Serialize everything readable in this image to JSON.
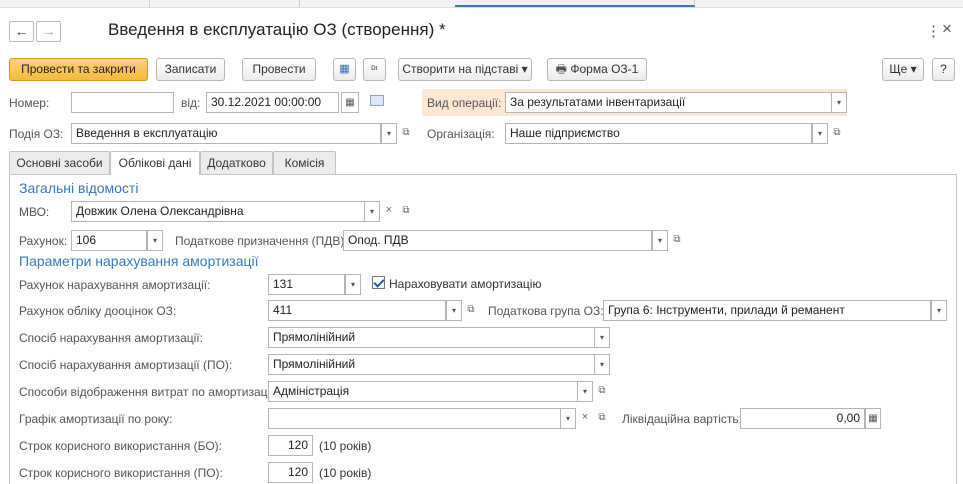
{
  "window": {
    "title": "Введення в експлуатацію ОЗ (створення) *"
  },
  "nav": {
    "back": "←",
    "forward": "→"
  },
  "window_controls": {
    "more": "⋮",
    "close": "×"
  },
  "toolbar": {
    "post_close": "Провести та закрити",
    "save": "Записати",
    "post": "Провести",
    "create_based": "Створити на підставі",
    "form_os1": "Форма ОЗ-1",
    "more": "Ще",
    "help": "?"
  },
  "header": {
    "number_label": "Номер:",
    "number_value": "",
    "date_label": "від:",
    "date_value": "30.12.2021 00:00:00",
    "operation_label": "Вид операції:",
    "operation_value": "За результатами інвентаризації",
    "event_label": "Подія ОЗ:",
    "event_value": "Введення в експлуатацію",
    "org_label": "Організація:",
    "org_value": "Наше підприємство"
  },
  "tabs": [
    {
      "label": "Основні засоби"
    },
    {
      "label": "Облікові дані"
    },
    {
      "label": "Додатково"
    },
    {
      "label": "Комісія"
    }
  ],
  "general": {
    "heading": "Загальні відомості",
    "mvo_label": "МВО:",
    "mvo_value": "Довжик Олена Олександрівна",
    "account_label": "Рахунок:",
    "account_value": "106",
    "tax_purpose_label": "Податкове призначення (ПДВ):",
    "tax_purpose_value": "Опод. ПДВ"
  },
  "depreciation": {
    "heading": "Параметри нарахування амортизації",
    "dep_account_label": "Рахунок нарахування амортизації:",
    "dep_account_value": "131",
    "accrue_label": "Нараховувати амортизацію",
    "accrue_checked": true,
    "reval_account_label": "Рахунок обліку дооцінок ОЗ:",
    "reval_account_value": "411",
    "tax_group_label": "Податкова група ОЗ:",
    "tax_group_value": "Група 6: Інструменти, прилади й реманент",
    "method_label": "Спосіб нарахування амортизації:",
    "method_value": "Прямолінійний",
    "method_po_label": "Спосіб нарахування амортизації (ПО):",
    "method_po_value": "Прямолінійний",
    "expense_label": "Способи відображення витрат по амортизації:",
    "expense_value": "Адміністрація",
    "schedule_label": "Графік амортизації по року:",
    "schedule_value": "",
    "liquidation_label": "Ліквідаційна вартість:",
    "liquidation_value": "0,00",
    "life_bo_label": "Строк корисного використання (БО):",
    "life_bo_value": "120",
    "life_bo_years": "(10 років)",
    "life_po_label": "Строк корисного використання (ПО):",
    "life_po_value": "120",
    "life_po_years": "(10 років)"
  },
  "icons": {
    "dropdown": "▾",
    "open": "⧉",
    "clear": "×",
    "calendar": "▦"
  }
}
